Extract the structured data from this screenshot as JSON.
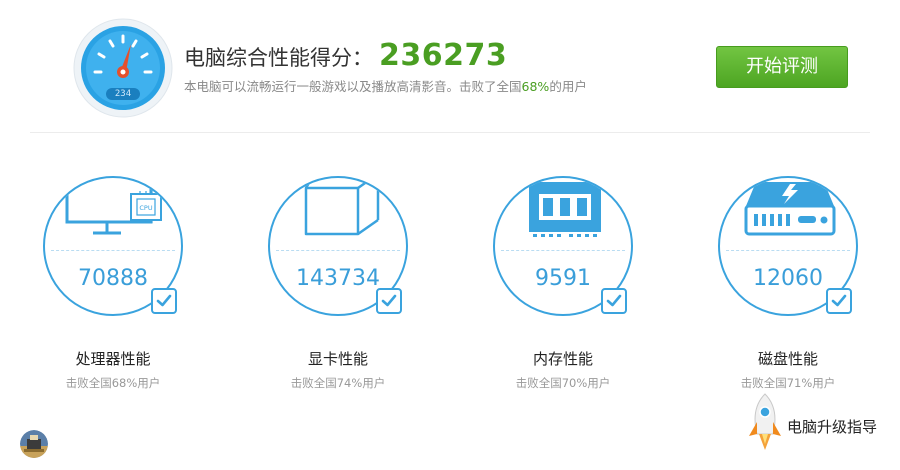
{
  "header": {
    "gauge_digits": "234",
    "title_label": "电脑综合性能得分：",
    "score": "236273",
    "subtitle_prefix": "本电脑可以流畅运行一般游戏以及播放高清影音。击败了全国",
    "subtitle_percent": "68%",
    "subtitle_suffix": "的用户",
    "start_button": "开始评测"
  },
  "cards": [
    {
      "icon": "monitor-cpu-icon",
      "chip_text": "CPU",
      "value": "70888",
      "label": "处理器性能",
      "sub": "击败全国68%用户"
    },
    {
      "icon": "graphics-card-icon",
      "value": "143734",
      "label": "显卡性能",
      "sub": "击败全国74%用户"
    },
    {
      "icon": "memory-chip-icon",
      "value": "9591",
      "label": "内存性能",
      "sub": "击败全国70%用户"
    },
    {
      "icon": "hard-disk-icon",
      "value": "12060",
      "label": "磁盘性能",
      "sub": "击败全国71%用户"
    }
  ],
  "upgrade": {
    "icon": "rocket-icon",
    "label": "电脑升级指导"
  },
  "avatar": {
    "icon": "user-avatar-icon"
  },
  "colors": {
    "accent_green": "#4a9e22",
    "accent_blue": "#3aa3de",
    "button_green": "#5cb52f"
  }
}
